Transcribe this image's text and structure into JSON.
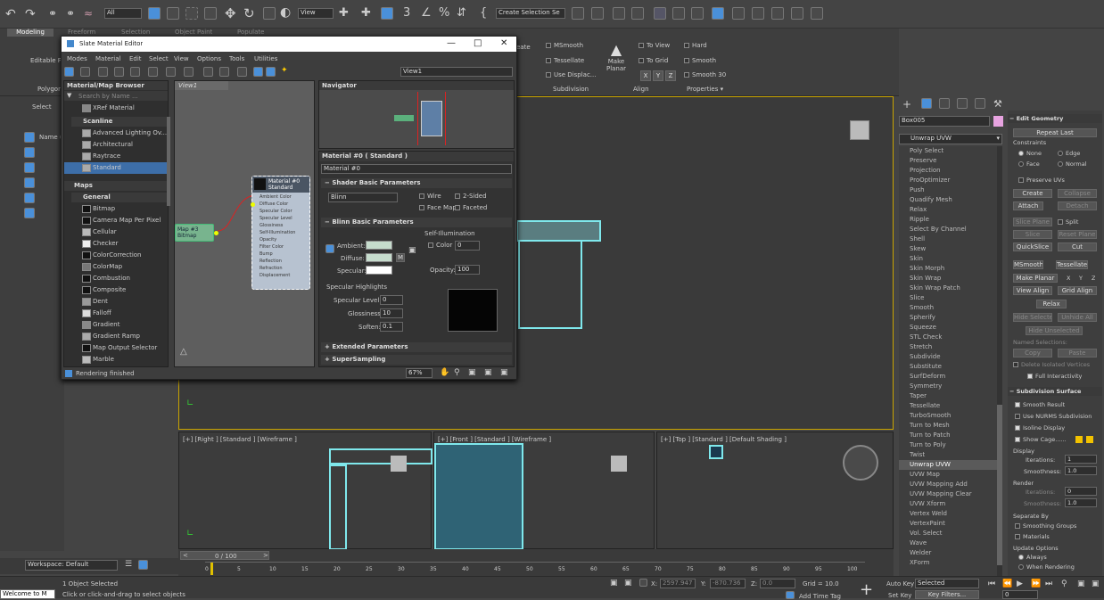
{
  "toolbar": {
    "filter_all": "All",
    "view_dropdown": "View",
    "create_selection_set": "Create Selection Se",
    "snap_3": "3"
  },
  "ribbon": {
    "tabs": [
      "Modeling",
      "Freeform",
      "Selection",
      "Object Paint",
      "Populate"
    ],
    "editable_poly": "Editable P",
    "polygon_label": "Polygon",
    "select_label": "Select",
    "msmooth": "MSmooth",
    "tessellate": "Tessellate",
    "use_displace": "Use Displac...",
    "make_planar": "Make\nPlanar",
    "to_view": "To View",
    "to_grid": "To Grid",
    "xyz": [
      "X",
      "Y",
      "Z"
    ],
    "hard": "Hard",
    "smooth": "Smooth",
    "smooth30": "Smooth 30",
    "subdivision": "Subdivision",
    "align": "Align",
    "properties": "Properties ▾",
    "create_partial": "eate"
  },
  "scene_explorer": {
    "name_col": "Name (S"
  },
  "slate": {
    "title": "Slate Material Editor",
    "menu": [
      "Modes",
      "Material",
      "Edit",
      "Select",
      "View",
      "Options",
      "Tools",
      "Utilities"
    ],
    "view_dropdown": "View1",
    "browser_title": "Material/Map Browser",
    "search": "Search by Name ...",
    "xref": "XRef Material",
    "scanline": "Scanline",
    "scanline_items": [
      "Advanced Lighting Ov...",
      "Architectural",
      "Raytrace",
      "Standard"
    ],
    "maps": "Maps",
    "general": "General",
    "map_items": [
      "Bitmap",
      "Camera Map Per Pixel",
      "Cellular",
      "Checker",
      "ColorCorrection",
      "ColorMap",
      "Combustion",
      "Composite",
      "Dent",
      "Falloff",
      "Gradient",
      "Gradient Ramp",
      "Map Output Selector",
      "Marble"
    ],
    "view1_tab": "View1",
    "navigator": "Navigator",
    "node_title": "Material #0",
    "node_type": "Standard",
    "node_slots": [
      "Ambient Color",
      "Diffuse Color",
      "Specular Color",
      "Specular Level",
      "Glossiness",
      "Self-Illumination",
      "Opacity",
      "Filter Color",
      "Bump",
      "Reflection",
      "Refraction",
      "Displacement"
    ],
    "bitmap_node": "Map #3\nBitmap",
    "param_header": "Material #0  ( Standard )",
    "material_name": "Material #0",
    "shader_basic": "Shader Basic Parameters",
    "shader": "Blinn",
    "wire": "Wire",
    "two_sided": "2-Sided",
    "face_map": "Face Map",
    "faceted": "Faceted",
    "blinn_basic": "Blinn Basic Parameters",
    "self_illum": "Self-Illumination",
    "ambient": "Ambient:",
    "diffuse": "Diffuse:",
    "specular": "Specular:",
    "color_label": "Color",
    "color_val": "0",
    "opacity_label": "Opacity:",
    "opacity_val": "100",
    "m_label": "M",
    "spec_highlights": "Specular Highlights",
    "spec_level": "Specular Level:",
    "spec_level_val": "0",
    "glossiness": "Glossiness:",
    "glossiness_val": "10",
    "soften": "Soften:",
    "soften_val": "0.1",
    "extended": "Extended Parameters",
    "supersampling": "SuperSampling",
    "zoom": "67%",
    "status": "Rendering finished"
  },
  "viewports": {
    "right": "[+] [Right ] [Standard ] [Wireframe ]",
    "front": "[+] [Front ] [Standard ] [Wireframe ]",
    "top": "[+] [Top ] [Standard ] [Default Shading ]"
  },
  "command_panel": {
    "object_name": "Box005",
    "modifier_dropdown": "Unwrap UVW",
    "modifiers": [
      "Poly Select",
      "Preserve",
      "Projection",
      "ProOptimizer",
      "Push",
      "Quadify Mesh",
      "Relax",
      "Ripple",
      "Select By Channel",
      "Shell",
      "Skew",
      "Skin",
      "Skin Morph",
      "Skin Wrap",
      "Skin Wrap Patch",
      "Slice",
      "Smooth",
      "Spherify",
      "Squeeze",
      "STL Check",
      "Stretch",
      "Subdivide",
      "Substitute",
      "SurfDeform",
      "Symmetry",
      "Taper",
      "Tessellate",
      "TurboSmooth",
      "Turn to Mesh",
      "Turn to Patch",
      "Turn to Poly",
      "Twist",
      "Unwrap UVW",
      "UVW Map",
      "UVW Mapping Add",
      "UVW Mapping Clear",
      "UVW Xform",
      "Vertex Weld",
      "VertexPaint",
      "Vol. Select",
      "Wave",
      "Welder",
      "XForm"
    ],
    "highlighted": "Unwrap UVW"
  },
  "edit_geometry": {
    "title": "Edit Geometry",
    "repeat_last": "Repeat Last",
    "constraints": "Constraints",
    "none": "None",
    "edge": "Edge",
    "face": "Face",
    "normal": "Normal",
    "preserve_uvs": "Preserve UVs",
    "create": "Create",
    "collapse": "Collapse",
    "attach": "Attach",
    "detach": "Detach",
    "slice_plane": "Slice Plane",
    "split": "Split",
    "slice": "Slice",
    "reset_plane": "Reset Plane",
    "quickslice": "QuickSlice",
    "cut": "Cut",
    "msmooth": "MSmooth",
    "tessellate": "Tessellate",
    "make_planar": "Make Planar",
    "x": "X",
    "y": "Y",
    "z": "Z",
    "view_align": "View Align",
    "grid_align": "Grid Align",
    "relax": "Relax",
    "hide_selected": "Hide Selected",
    "unhide_all": "Unhide All",
    "hide_unselected": "Hide Unselected",
    "named_selections": "Named Selections:",
    "copy": "Copy",
    "paste": "Paste",
    "delete_isolated": "Delete Isolated Vertices",
    "full_interactivity": "Full Interactivity"
  },
  "subdivision_surface": {
    "title": "Subdivision Surface",
    "smooth_result": "Smooth Result",
    "use_nurms": "Use NURMS Subdivision",
    "isoline": "Isoline Display",
    "show_cage": "Show Cage......",
    "display": "Display",
    "iterations": "Iterations:",
    "iterations_val": "1",
    "smoothness": "Smoothness:",
    "smoothness_val": "1.0",
    "render": "Render",
    "render_iter_val": "0",
    "render_smooth_val": "1.0",
    "separate_by": "Separate By",
    "smoothing_groups": "Smoothing Groups",
    "materials": "Materials",
    "update_options": "Update Options",
    "always": "Always",
    "when_rendering": "When Rendering"
  },
  "timeline": {
    "frame": "0 / 100",
    "ticks": [
      "0",
      "5",
      "10",
      "15",
      "20",
      "25",
      "30",
      "35",
      "40",
      "45",
      "50",
      "55",
      "60",
      "65",
      "70",
      "75",
      "80",
      "85",
      "90",
      "95",
      "100"
    ]
  },
  "statusbar": {
    "workspace": "Workspace: Default",
    "objects_selected": "1 Object Selected",
    "hint": "Click or click-and-drag to select objects",
    "welcome": "Welcome to M",
    "x_label": "X:",
    "x_val": "2597.947",
    "y_label": "Y:",
    "y_val": "-870.736",
    "z_label": "Z:",
    "z_val": "0.0",
    "grid": "Grid = 10.0",
    "add_time_tag": "Add Time Tag",
    "auto_key": "Auto Key",
    "selected": "Selected",
    "set_key": "Set Key",
    "key_filters": "Key Filters...",
    "frame_field": "0"
  },
  "colors": {
    "cyan": "#7fe8ec",
    "accent_blue": "#4a90d9",
    "selection_blue": "#3d6ea8"
  }
}
